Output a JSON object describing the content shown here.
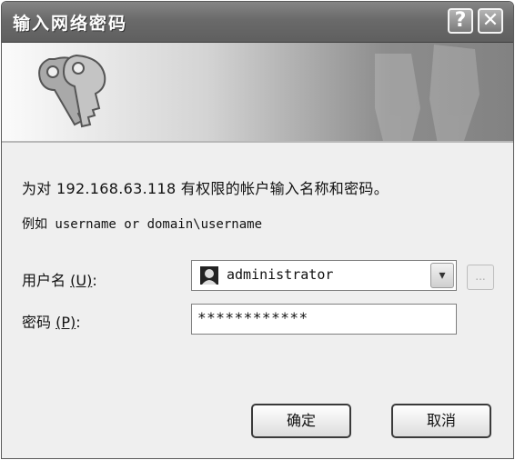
{
  "window": {
    "title": "输入网络密码",
    "help_glyph": "?",
    "close_glyph": "✕"
  },
  "banner": {
    "icon": "keys-icon"
  },
  "message": {
    "line1": "为对 192.168.63.118 有权限的帐户输入名称和密码。",
    "line2": "例如 username or domain\\username"
  },
  "form": {
    "username_label_prefix": "用户名",
    "username_label_mnemonic": "(U)",
    "username_label_suffix": ":",
    "username_value": "administrator",
    "username_icon": "user-icon",
    "browse_label": "...",
    "password_label_prefix": "密码",
    "password_label_mnemonic": "(P)",
    "password_label_suffix": ":",
    "password_value": "************"
  },
  "buttons": {
    "ok_label": "确定",
    "cancel_label": "取消"
  }
}
